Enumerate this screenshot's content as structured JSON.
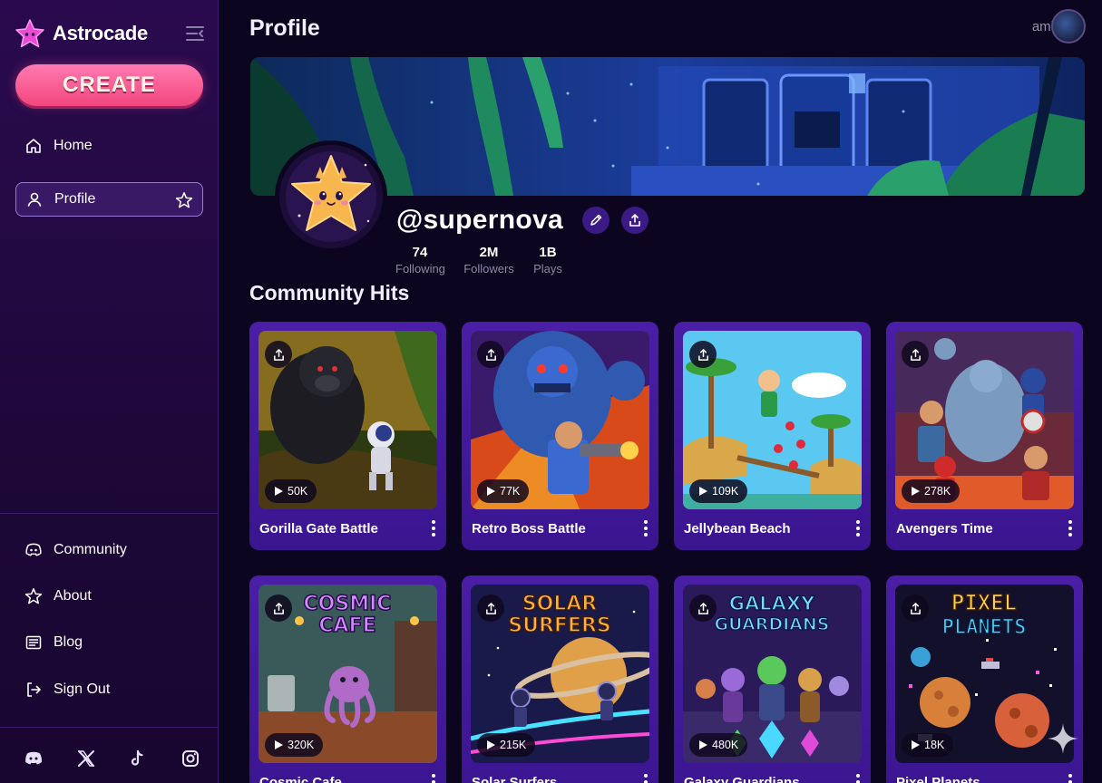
{
  "app": {
    "name": "Astrocade",
    "create_label": "CREATE"
  },
  "nav": {
    "primary": [
      {
        "label": "Home",
        "icon": "home-icon"
      },
      {
        "label": "Profile",
        "icon": "user-icon",
        "active": true
      }
    ],
    "secondary": [
      {
        "label": "Community",
        "icon": "discord-icon"
      },
      {
        "label": "About",
        "icon": "star-icon"
      },
      {
        "label": "Blog",
        "icon": "newspaper-icon"
      },
      {
        "label": "Sign Out",
        "icon": "sign-out-icon"
      }
    ],
    "social": [
      "discord-icon",
      "x-icon",
      "tiktok-icon",
      "instagram-icon"
    ]
  },
  "header": {
    "title": "Profile",
    "user": "amir"
  },
  "profile": {
    "username": "@supernova",
    "stats": [
      {
        "value": "74",
        "label": "Following"
      },
      {
        "value": "2M",
        "label": "Followers"
      },
      {
        "value": "1B",
        "label": "Plays"
      }
    ]
  },
  "section": {
    "title": "Community Hits"
  },
  "games": [
    {
      "title": "Gorilla Gate Battle",
      "plays": "50K"
    },
    {
      "title": "Retro Boss Battle",
      "plays": "77K"
    },
    {
      "title": "Jellybean Beach",
      "plays": "109K"
    },
    {
      "title": "Avengers Time",
      "plays": "278K"
    },
    {
      "title": "Cosmic Cafe",
      "plays": "320K",
      "art_text": [
        "COSMIC",
        "CAFE"
      ]
    },
    {
      "title": "Solar Surfers",
      "plays": "215K",
      "art_text": [
        "SOLAR",
        "SURFERS"
      ]
    },
    {
      "title": "Galaxy Guardians",
      "plays": "480K",
      "art_text": [
        "GALAXY",
        "GUARDIANS"
      ]
    },
    {
      "title": "Pixel Planets",
      "plays": "18K",
      "art_text": [
        "PIXEL",
        "PLANETS"
      ]
    }
  ],
  "colors": {
    "accent": "#f2467e",
    "card": "#4a1ea6",
    "sidebar": "#2a0a4e",
    "background": "#0b0520"
  }
}
